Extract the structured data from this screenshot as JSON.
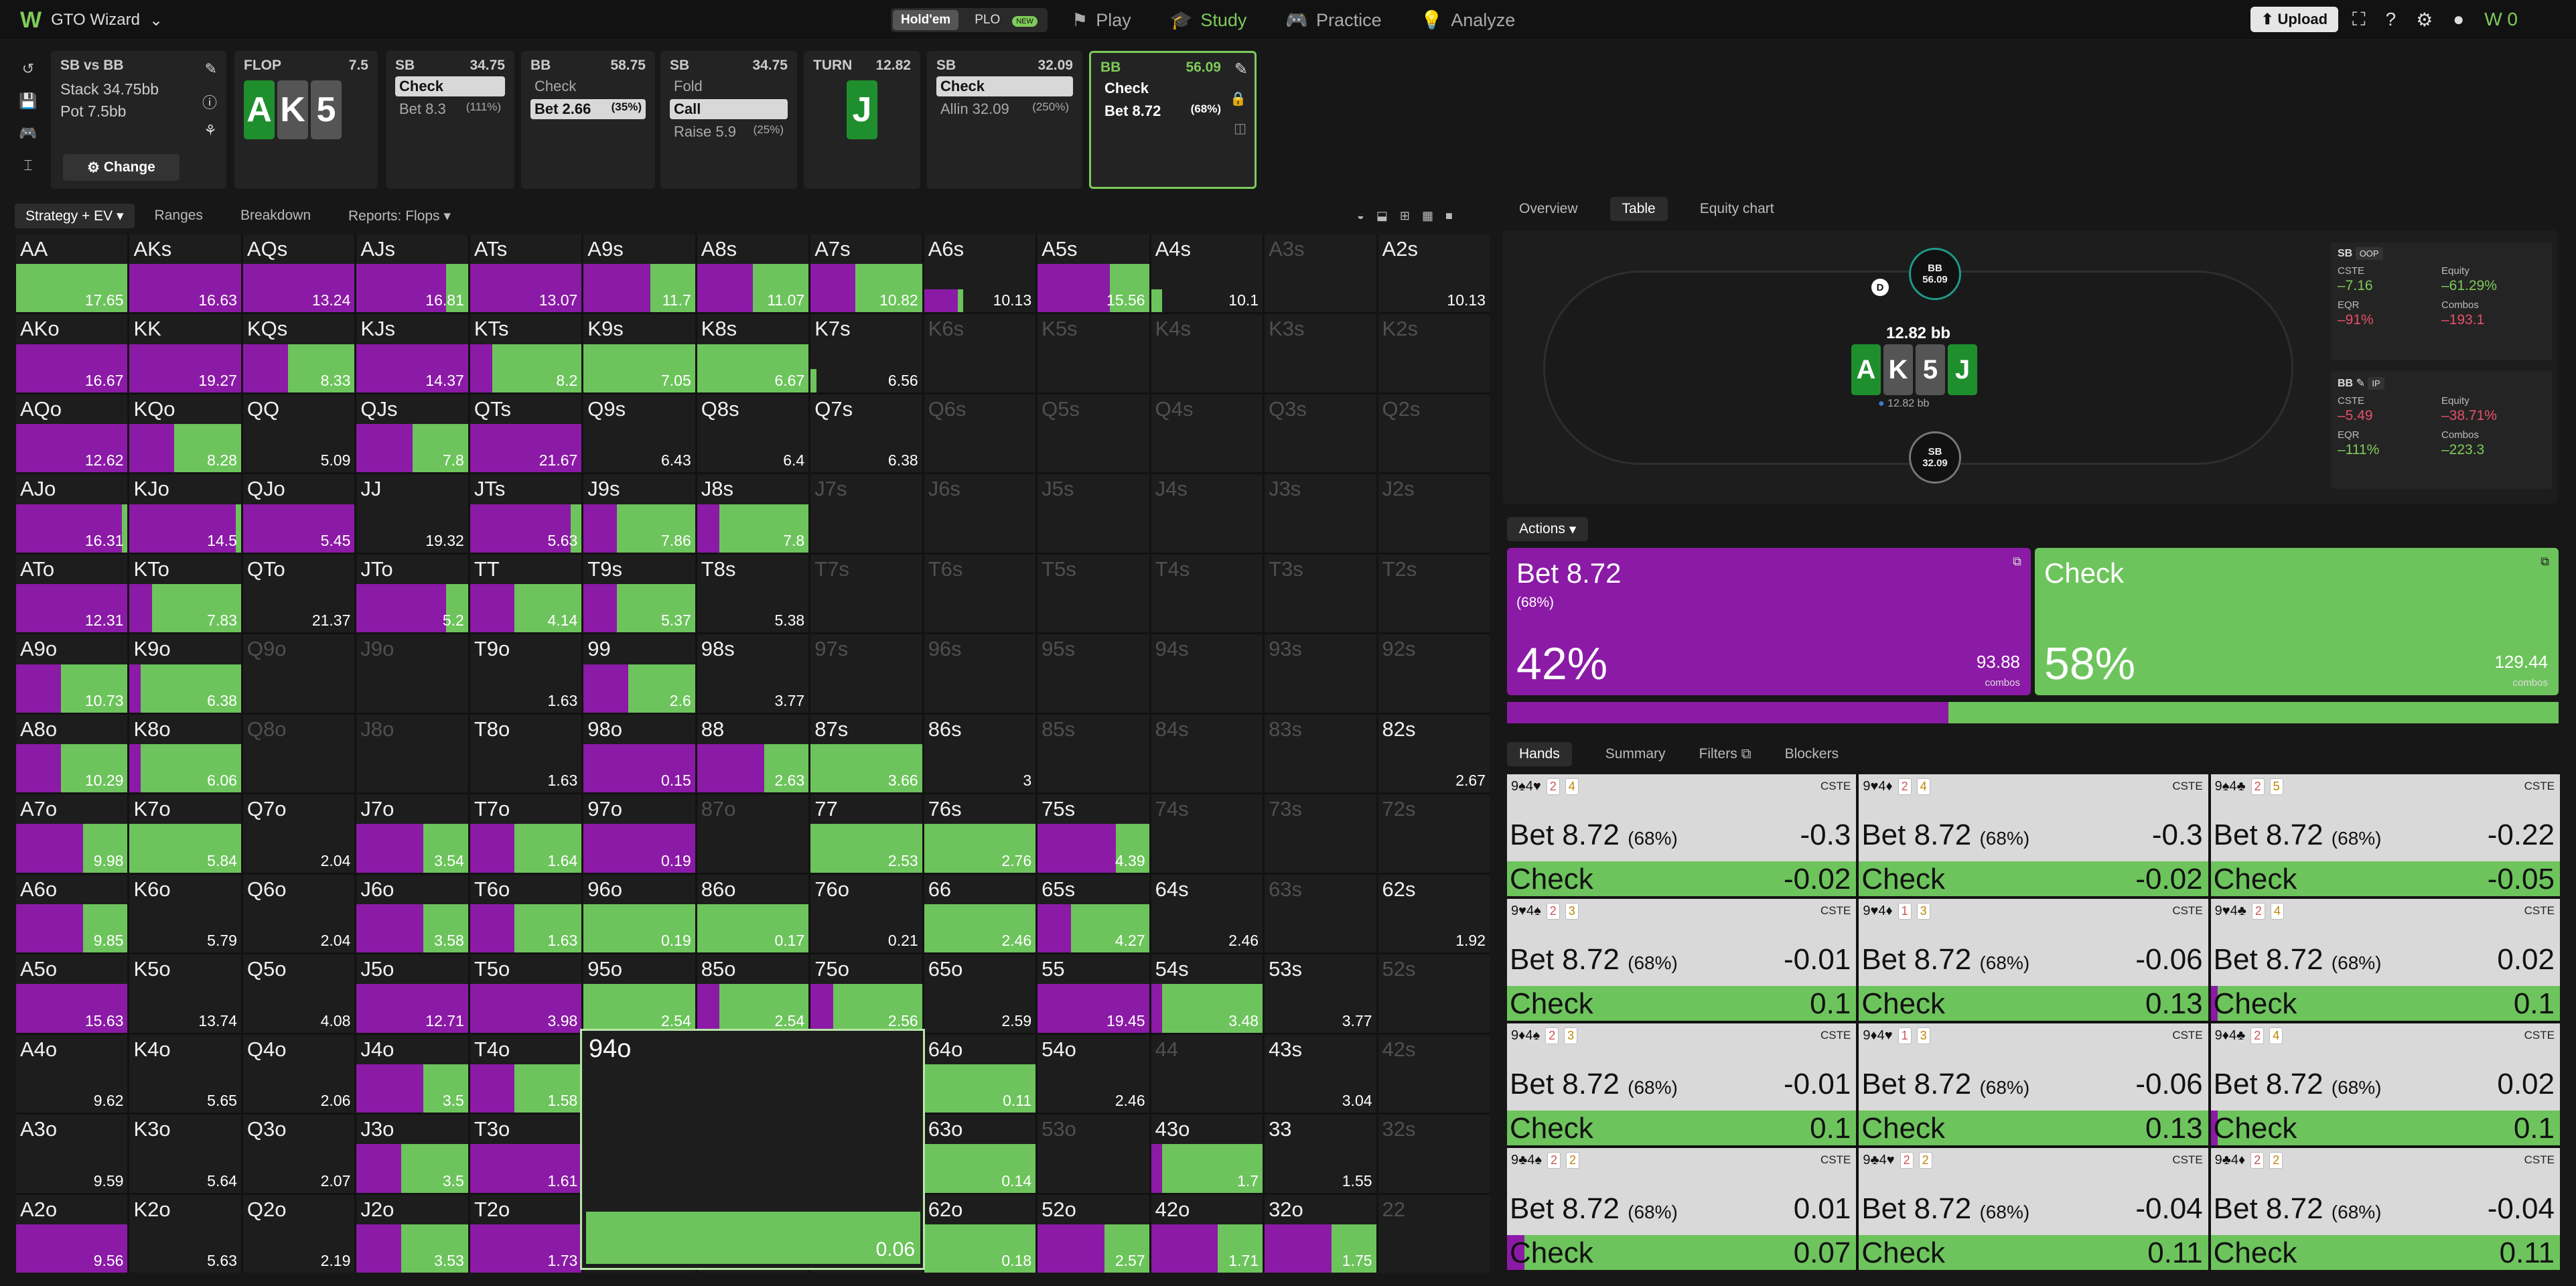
{
  "topbar": {
    "brand": "GTO Wizard",
    "game_holdem": "Hold'em",
    "game_plo": "PLO",
    "plo_badge": "NEW",
    "nav": [
      "Play",
      "Study",
      "Practice",
      "Analyze"
    ],
    "upload": "Upload"
  },
  "cards": {
    "matchup": {
      "title": "SB vs BB",
      "stack": "Stack 34.75bb",
      "pot": "Pot 7.5bb",
      "change": "Change"
    },
    "flop": {
      "title": "FLOP",
      "amount": "7.5",
      "cards": [
        "A",
        "K",
        "5"
      ]
    },
    "sb1": {
      "title": "SB",
      "amount": "34.75",
      "opt1": "Check",
      "opt2": "Bet 8.3",
      "opt2_pct": "(111%)"
    },
    "bb1": {
      "title": "BB",
      "amount": "58.75",
      "opt1": "Check",
      "opt2": "Bet 2.66",
      "opt2_pct": "(35%)"
    },
    "sb2": {
      "title": "SB",
      "amount": "34.75",
      "opt1": "Fold",
      "opt2": "Call",
      "opt3": "Raise 5.9",
      "opt3_pct": "(25%)"
    },
    "turn": {
      "title": "TURN",
      "amount": "12.82",
      "card": "J"
    },
    "sb3": {
      "title": "SB",
      "amount": "32.09",
      "opt1": "Check",
      "opt2": "Allin 32.09",
      "opt2_pct": "(250%)"
    },
    "bb2": {
      "title": "BB",
      "amount": "56.09",
      "opt1": "Check",
      "opt2": "Bet 8.72",
      "opt2_pct": "(68%)"
    }
  },
  "strategy_toolbar": {
    "mode": "Strategy + EV",
    "tabs": [
      "Ranges",
      "Breakdown",
      "Reports: Flops"
    ]
  },
  "grid": [
    [
      [
        "AA",
        "17.65",
        0,
        100
      ],
      [
        "AKs",
        "16.63",
        100,
        0
      ],
      [
        "AQs",
        "13.24",
        100,
        0
      ],
      [
        "AJs",
        "16.81",
        80,
        20
      ],
      [
        "ATs",
        "13.07",
        100,
        0
      ],
      [
        "A9s",
        "11.7",
        60,
        40
      ],
      [
        "A8s",
        "11.07",
        50,
        50
      ],
      [
        "A7s",
        "10.82",
        40,
        60
      ],
      [
        "A6s",
        "10.13",
        30,
        5
      ],
      [
        "A5s",
        "15.56",
        65,
        35
      ],
      [
        "A4s",
        "10.1",
        0,
        10
      ],
      [
        "A3s",
        "",
        0,
        0
      ],
      [
        "A2s",
        "10.13",
        0,
        0
      ]
    ],
    [
      [
        "AKo",
        "16.67",
        100,
        0
      ],
      [
        "KK",
        "19.27",
        100,
        0
      ],
      [
        "KQs",
        "8.33",
        40,
        60
      ],
      [
        "KJs",
        "14.37",
        100,
        0
      ],
      [
        "KTs",
        "8.2",
        20,
        80
      ],
      [
        "K9s",
        "7.05",
        0,
        100
      ],
      [
        "K8s",
        "6.67",
        0,
        100
      ],
      [
        "K7s",
        "6.56",
        0,
        5
      ],
      [
        "K6s",
        "",
        0,
        0
      ],
      [
        "K5s",
        "",
        0,
        0
      ],
      [
        "K4s",
        "",
        0,
        0
      ],
      [
        "K3s",
        "",
        0,
        0
      ],
      [
        "K2s",
        "",
        0,
        0
      ]
    ],
    [
      [
        "AQo",
        "12.62",
        100,
        0
      ],
      [
        "KQo",
        "8.28",
        40,
        60
      ],
      [
        "QQ",
        "5.09",
        0,
        0
      ],
      [
        "QJs",
        "7.8",
        50,
        50
      ],
      [
        "QTs",
        "21.67",
        100,
        0
      ],
      [
        "Q9s",
        "6.43",
        0,
        0
      ],
      [
        "Q8s",
        "6.4",
        0,
        0
      ],
      [
        "Q7s",
        "6.38",
        0,
        0
      ],
      [
        "Q6s",
        "",
        0,
        0
      ],
      [
        "Q5s",
        "",
        0,
        0
      ],
      [
        "Q4s",
        "",
        0,
        0
      ],
      [
        "Q3s",
        "",
        0,
        0
      ],
      [
        "Q2s",
        "",
        0,
        0
      ]
    ],
    [
      [
        "AJo",
        "16.31",
        95,
        5
      ],
      [
        "KJo",
        "14.5",
        95,
        5
      ],
      [
        "QJo",
        "5.45",
        100,
        0
      ],
      [
        "JJ",
        "19.32",
        0,
        0
      ],
      [
        "JTs",
        "5.63",
        90,
        10
      ],
      [
        "J9s",
        "7.86",
        30,
        70
      ],
      [
        "J8s",
        "7.8",
        20,
        80
      ],
      [
        "J7s",
        "",
        0,
        0
      ],
      [
        "J6s",
        "",
        0,
        0
      ],
      [
        "J5s",
        "",
        0,
        0
      ],
      [
        "J4s",
        "",
        0,
        0
      ],
      [
        "J3s",
        "",
        0,
        0
      ],
      [
        "J2s",
        "",
        0,
        0
      ]
    ],
    [
      [
        "ATo",
        "12.31",
        100,
        0
      ],
      [
        "KTo",
        "7.83",
        20,
        80
      ],
      [
        "QTo",
        "21.37",
        0,
        0
      ],
      [
        "JTo",
        "5.2",
        80,
        20
      ],
      [
        "TT",
        "4.14",
        40,
        60
      ],
      [
        "T9s",
        "5.37",
        30,
        70
      ],
      [
        "T8s",
        "5.38",
        0,
        0
      ],
      [
        "T7s",
        "",
        0,
        0
      ],
      [
        "T6s",
        "",
        0,
        0
      ],
      [
        "T5s",
        "",
        0,
        0
      ],
      [
        "T4s",
        "",
        0,
        0
      ],
      [
        "T3s",
        "",
        0,
        0
      ],
      [
        "T2s",
        "",
        0,
        0
      ]
    ],
    [
      [
        "A9o",
        "10.73",
        40,
        60
      ],
      [
        "K9o",
        "6.38",
        10,
        90
      ],
      [
        "Q9o",
        "",
        0,
        0
      ],
      [
        "J9o",
        "",
        0,
        0
      ],
      [
        "T9o",
        "1.63",
        0,
        0
      ],
      [
        "99",
        "2.6",
        40,
        60
      ],
      [
        "98s",
        "3.77",
        0,
        0
      ],
      [
        "97s",
        "",
        0,
        0
      ],
      [
        "96s",
        "",
        0,
        0
      ],
      [
        "95s",
        "",
        0,
        0
      ],
      [
        "94s",
        "",
        0,
        0
      ],
      [
        "93s",
        "",
        0,
        0
      ],
      [
        "92s",
        "",
        0,
        0
      ]
    ],
    [
      [
        "A8o",
        "10.29",
        40,
        60
      ],
      [
        "K8o",
        "6.06",
        10,
        90
      ],
      [
        "Q8o",
        "",
        0,
        0
      ],
      [
        "J8o",
        "",
        0,
        0
      ],
      [
        "T8o",
        "1.63",
        0,
        0
      ],
      [
        "98o",
        "0.15",
        100,
        0
      ],
      [
        "88",
        "2.63",
        60,
        40
      ],
      [
        "87s",
        "3.66",
        0,
        100
      ],
      [
        "86s",
        "3",
        0,
        0
      ],
      [
        "85s",
        "",
        0,
        0
      ],
      [
        "84s",
        "",
        0,
        0
      ],
      [
        "83s",
        "",
        0,
        0
      ],
      [
        "82s",
        "2.67",
        0,
        0
      ]
    ],
    [
      [
        "A7o",
        "9.98",
        60,
        40
      ],
      [
        "K7o",
        "5.84",
        0,
        100
      ],
      [
        "Q7o",
        "2.04",
        0,
        0
      ],
      [
        "J7o",
        "3.54",
        60,
        40
      ],
      [
        "T7o",
        "1.64",
        40,
        60
      ],
      [
        "97o",
        "0.19",
        100,
        0
      ],
      [
        "87o",
        "",
        0,
        0
      ],
      [
        "77",
        "2.53",
        0,
        100
      ],
      [
        "76s",
        "2.76",
        0,
        100
      ],
      [
        "75s",
        "4.39",
        70,
        30
      ],
      [
        "74s",
        "",
        0,
        0
      ],
      [
        "73s",
        "",
        0,
        0
      ],
      [
        "72s",
        "",
        0,
        0
      ]
    ],
    [
      [
        "A6o",
        "9.85",
        60,
        40
      ],
      [
        "K6o",
        "5.79",
        0,
        0
      ],
      [
        "Q6o",
        "2.04",
        0,
        0
      ],
      [
        "J6o",
        "3.58",
        60,
        40
      ],
      [
        "T6o",
        "1.63",
        40,
        60
      ],
      [
        "96o",
        "0.19",
        0,
        100
      ],
      [
        "86o",
        "0.17",
        0,
        100
      ],
      [
        "76o",
        "0.21",
        0,
        0
      ],
      [
        "66",
        "2.46",
        0,
        100
      ],
      [
        "65s",
        "4.27",
        30,
        70
      ],
      [
        "64s",
        "2.46",
        0,
        0
      ],
      [
        "63s",
        "",
        0,
        0
      ],
      [
        "62s",
        "1.92",
        0,
        0
      ]
    ],
    [
      [
        "A5o",
        "15.63",
        100,
        0
      ],
      [
        "K5o",
        "13.74",
        0,
        0
      ],
      [
        "Q5o",
        "4.08",
        0,
        0
      ],
      [
        "J5o",
        "12.71",
        100,
        0
      ],
      [
        "T5o",
        "3.98",
        100,
        0
      ],
      [
        "95o",
        "2.54",
        0,
        100
      ],
      [
        "85o",
        "2.54",
        20,
        80
      ],
      [
        "75o",
        "2.56",
        20,
        80
      ],
      [
        "65o",
        "2.59",
        0,
        0
      ],
      [
        "55",
        "19.45",
        100,
        0
      ],
      [
        "54s",
        "3.48",
        10,
        90
      ],
      [
        "53s",
        "3.77",
        0,
        0
      ],
      [
        "52s",
        "",
        0,
        0
      ]
    ],
    [
      [
        "A4o",
        "9.62",
        0,
        0
      ],
      [
        "K4o",
        "5.65",
        0,
        0
      ],
      [
        "Q4o",
        "2.06",
        0,
        0
      ],
      [
        "J4o",
        "3.5",
        60,
        40
      ],
      [
        "T4o",
        "1.58",
        40,
        60
      ],
      [
        "94o",
        "",
        0,
        0
      ],
      [
        "84o",
        "",
        0,
        0
      ],
      [
        "74o",
        "",
        0,
        0
      ],
      [
        "64o",
        "0.11",
        0,
        100
      ],
      [
        "54o",
        "2.46",
        0,
        0
      ],
      [
        "44",
        "",
        0,
        0
      ],
      [
        "43s",
        "3.04",
        0,
        0
      ],
      [
        "42s",
        "",
        0,
        0
      ]
    ],
    [
      [
        "A3o",
        "9.59",
        0,
        0
      ],
      [
        "K3o",
        "5.64",
        0,
        0
      ],
      [
        "Q3o",
        "2.07",
        0,
        0
      ],
      [
        "J3o",
        "3.5",
        40,
        60
      ],
      [
        "T3o",
        "1.61",
        100,
        0
      ],
      [
        "93o",
        "",
        0,
        0
      ],
      [
        "83o",
        "",
        0,
        0
      ],
      [
        "73o",
        "",
        0,
        0
      ],
      [
        "63o",
        "0.14",
        0,
        100
      ],
      [
        "53o",
        "",
        0,
        0
      ],
      [
        "43o",
        "1.7",
        10,
        90
      ],
      [
        "33",
        "1.55",
        0,
        0
      ],
      [
        "32s",
        "",
        0,
        0
      ]
    ],
    [
      [
        "A2o",
        "9.56",
        100,
        0
      ],
      [
        "K2o",
        "5.63",
        0,
        0
      ],
      [
        "Q2o",
        "2.19",
        0,
        0
      ],
      [
        "J2o",
        "3.53",
        40,
        60
      ],
      [
        "T2o",
        "1.73",
        100,
        0
      ],
      [
        "92o",
        "",
        0,
        0
      ],
      [
        "82o",
        "",
        0,
        0
      ],
      [
        "72o",
        "",
        0,
        0
      ],
      [
        "62o",
        "0.18",
        0,
        100
      ],
      [
        "52o",
        "2.57",
        60,
        40
      ],
      [
        "42o",
        "1.71",
        60,
        40
      ],
      [
        "32o",
        "1.75",
        60,
        40
      ],
      [
        "22",
        "",
        0,
        0
      ]
    ]
  ],
  "hover_cell": {
    "name": "94o",
    "ev": "0.06"
  },
  "right_tabs": [
    "Overview",
    "Table",
    "Equity chart"
  ],
  "table": {
    "bb_seat": "BB",
    "bb_stack": "56.09",
    "sb_seat": "SB",
    "sb_stack": "32.09",
    "pot": "12.82 bb",
    "pot_small": "12.82 bb",
    "board": [
      "A",
      "K",
      "5",
      "J"
    ],
    "sb_stats": {
      "label": "SB",
      "pos": "OOP",
      "cste_k": "CSTE",
      "cste": "–7.16",
      "eq_k": "Equity",
      "eq": "–61.29%",
      "eqr_k": "EQR",
      "eqr": "–91%",
      "co_k": "Combos",
      "co": "–193.1"
    },
    "bb_stats": {
      "label": "BB",
      "pos": "IP",
      "cste_k": "CSTE",
      "cste": "–5.49",
      "eq_k": "Equity",
      "eq": "–38.71%",
      "eqr_k": "EQR",
      "eqr": "–111%",
      "co_k": "Combos",
      "co": "–223.3"
    }
  },
  "actions_label": "Actions",
  "action_bet": {
    "name": "Bet 8.72",
    "sub": "(68%)",
    "pct": "42%",
    "combos": "93.88",
    "combos_label": "combos"
  },
  "action_check": {
    "name": "Check",
    "pct": "58%",
    "combos": "129.44",
    "combos_label": "combos"
  },
  "hand_tabs": [
    "Hands",
    "Summary",
    "Filters",
    "Blockers"
  ],
  "hands": [
    {
      "cards": "9♠4♥",
      "b1": "2",
      "b2": "4",
      "bet_ev": "-0.3",
      "chk_ev": "-0.02",
      "pu": 0,
      "gr": 100
    },
    {
      "cards": "9♥4♦",
      "b1": "2",
      "b2": "4",
      "bet_ev": "-0.3",
      "chk_ev": "-0.02",
      "pu": 0,
      "gr": 100
    },
    {
      "cards": "9♠4♣",
      "b1": "2",
      "b2": "5",
      "bet_ev": "-0.22",
      "chk_ev": "-0.05",
      "pu": 0,
      "gr": 100
    },
    {
      "cards": "9♥4♠",
      "b1": "2",
      "b2": "3",
      "bet_ev": "-0.01",
      "chk_ev": "0.1",
      "pu": 0,
      "gr": 100
    },
    {
      "cards": "9♥4♦",
      "b1": "1",
      "b2": "3",
      "bet_ev": "-0.06",
      "chk_ev": "0.13",
      "pu": 0,
      "gr": 100
    },
    {
      "cards": "9♥4♣",
      "b1": "2",
      "b2": "4",
      "bet_ev": "0.02",
      "chk_ev": "0.1",
      "pu": 2,
      "gr": 100
    },
    {
      "cards": "9♦4♠",
      "b1": "2",
      "b2": "3",
      "bet_ev": "-0.01",
      "chk_ev": "0.1",
      "pu": 0,
      "gr": 100
    },
    {
      "cards": "9♦4♥",
      "b1": "1",
      "b2": "3",
      "bet_ev": "-0.06",
      "chk_ev": "0.13",
      "pu": 0,
      "gr": 100
    },
    {
      "cards": "9♦4♣",
      "b1": "2",
      "b2": "4",
      "bet_ev": "0.02",
      "chk_ev": "0.1",
      "pu": 2,
      "gr": 100
    },
    {
      "cards": "9♣4♠",
      "b1": "2",
      "b2": "2",
      "bet_ev": "0.01",
      "chk_ev": "0.07",
      "pu": 5,
      "gr": 100
    },
    {
      "cards": "9♣4♥",
      "b1": "2",
      "b2": "2",
      "bet_ev": "-0.04",
      "chk_ev": "0.11",
      "pu": 0,
      "gr": 100
    },
    {
      "cards": "9♣4♦",
      "b1": "2",
      "b2": "2",
      "bet_ev": "-0.04",
      "chk_ev": "0.11",
      "pu": 0,
      "gr": 100
    }
  ],
  "hand_cs": "CSTE",
  "hand_bet_label": "Bet 8.72",
  "hand_bet_pct": "(68%)",
  "hand_chk_label": "Check",
  "colors": {
    "bet": "#8b1aa6",
    "check": "#6dc45c",
    "accent": "#7ecb5a"
  }
}
